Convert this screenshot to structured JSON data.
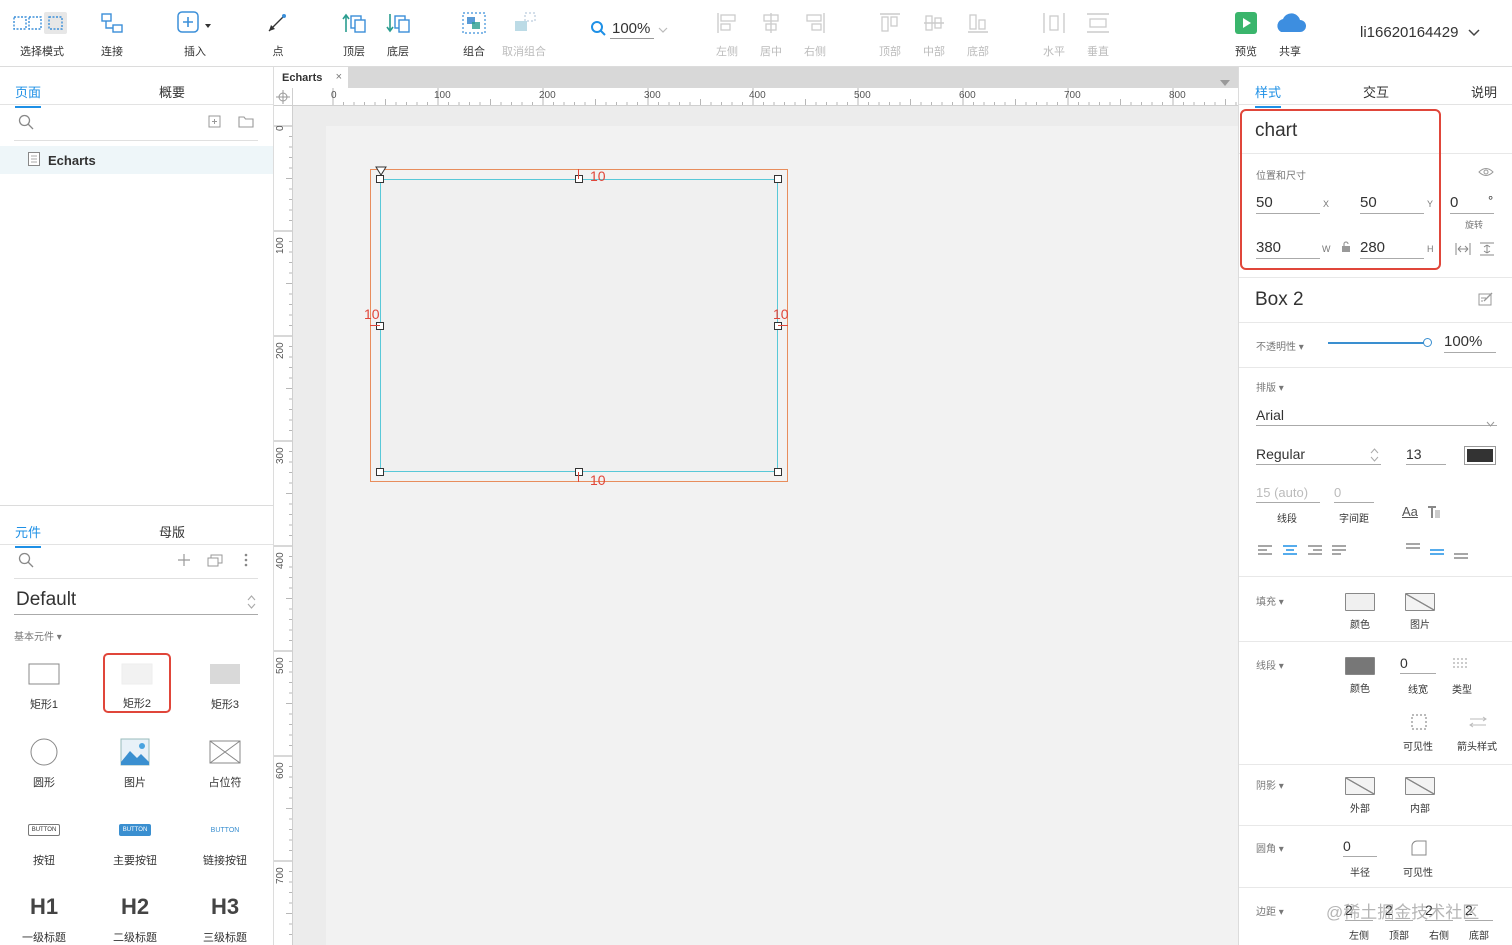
{
  "toolbar": {
    "select_mode": "选择模式",
    "connect": "连接",
    "insert": "插入",
    "point": "点",
    "top_layer": "顶层",
    "bottom_layer": "底层",
    "group": "组合",
    "ungroup": "取消组合",
    "zoom": "100%",
    "align_left": "左侧",
    "align_center": "居中",
    "align_right": "右侧",
    "align_top": "顶部",
    "align_middle": "中部",
    "align_bottom": "底部",
    "distribute_h": "水平",
    "distribute_v": "垂直",
    "preview": "预览",
    "share": "共享",
    "username": "li16620164429"
  },
  "left": {
    "tab_pages": "页面",
    "tab_outline": "概要",
    "page_name": "Echarts",
    "tab_widgets": "元件",
    "tab_masters": "母版",
    "library": "Default",
    "category": "基本元件 ▾",
    "widgets": [
      {
        "label": "矩形1"
      },
      {
        "label": "矩形2"
      },
      {
        "label": "矩形3"
      },
      {
        "label": "圆形"
      },
      {
        "label": "图片"
      },
      {
        "label": "占位符"
      },
      {
        "label": "按钮",
        "icon_text": "BUTTON"
      },
      {
        "label": "主要按钮",
        "icon_text": "BUTTON"
      },
      {
        "label": "链接按钮",
        "icon_text": "BUTTON"
      },
      {
        "label": "一级标题",
        "icon_text": "H1"
      },
      {
        "label": "二级标题",
        "icon_text": "H2"
      },
      {
        "label": "三级标题",
        "icon_text": "H3"
      }
    ]
  },
  "center": {
    "doc_tab": "Echarts",
    "close": "×",
    "ruler_h": [
      "0",
      "100",
      "200",
      "300",
      "400",
      "500",
      "600",
      "700",
      "800"
    ],
    "ruler_v": [
      "0",
      "100",
      "200",
      "300",
      "400",
      "500",
      "600",
      "700"
    ],
    "padding_labels": {
      "top": "10",
      "bottom": "10",
      "left": "10",
      "right": "10"
    }
  },
  "right": {
    "tab_style": "样式",
    "tab_interact": "交互",
    "tab_notes": "说明",
    "widget_name": "chart",
    "pos_size_label": "位置和尺寸",
    "x": "50",
    "x_label": "X",
    "y": "50",
    "y_label": "Y",
    "rotation": "0",
    "rotation_unit": "°",
    "rotation_label": "旋转",
    "w": "380",
    "w_label": "W",
    "h": "280",
    "h_label": "H",
    "style_name": "Box 2",
    "opacity_label": "不透明性 ▾",
    "opacity": "100%",
    "opacity_fraction": 1.0,
    "typography_label": "排版 ▾",
    "font": "Arial",
    "font_style": "Regular",
    "font_size": "13",
    "line_height": "15 (auto)",
    "letter_spacing": "0",
    "line_height_label": "线段",
    "letter_spacing_label": "字间距",
    "fill_label": "填充 ▾",
    "fill_color_label": "颜色",
    "fill_image_label": "图片",
    "border_label": "线段 ▾",
    "border_color_label": "颜色",
    "border_width": "0",
    "border_width_label": "线宽",
    "border_type_label": "类型",
    "visibility_label": "可见性",
    "arrow_label": "箭头样式",
    "shadow_label": "阴影 ▾",
    "shadow_outer": "外部",
    "shadow_inner": "内部",
    "radius_label": "圆角 ▾",
    "radius": "0",
    "radius_sub": "半径",
    "radius_visibility": "可见性",
    "padding_label": "边距 ▾",
    "padding_values": [
      "2",
      "2",
      "2",
      "2"
    ],
    "padding_sides": [
      "左侧",
      "顶部",
      "右侧",
      "底部"
    ]
  },
  "watermark": "@稀土掘金技术社区",
  "colors": {
    "accent": "#1e90e6",
    "highlight": "#e0463a",
    "selection_outer": "#e88d5c",
    "selection_inner": "#58c8d8"
  }
}
